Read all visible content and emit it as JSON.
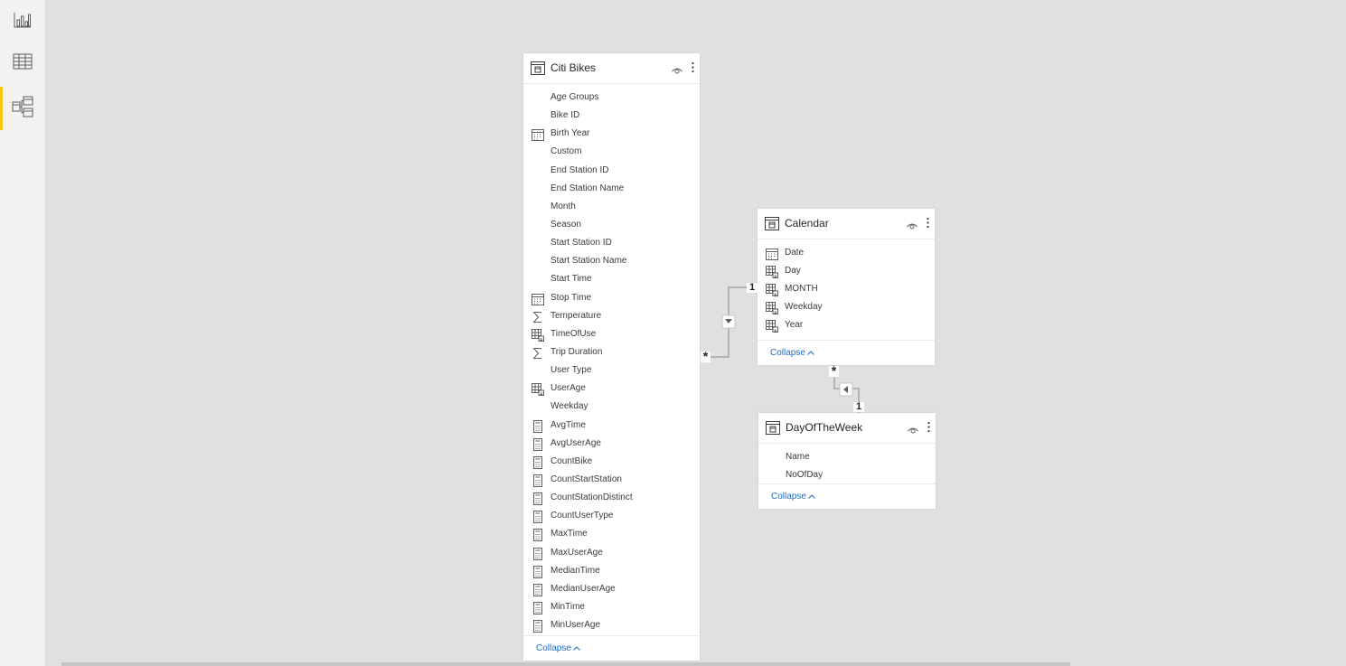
{
  "nav": {
    "items": [
      {
        "name": "report-view",
        "icon": "bar-chart-icon"
      },
      {
        "name": "data-view",
        "icon": "table-grid-icon"
      },
      {
        "name": "model-view",
        "icon": "model-diagram-icon",
        "active": true
      }
    ],
    "accent_color": "#f2c811"
  },
  "tables": {
    "citi_bikes": {
      "title": "Citi Bikes",
      "collapse_label": "Collapse",
      "fields": [
        {
          "name": "Age Groups",
          "icon": "none"
        },
        {
          "name": "Bike ID",
          "icon": "none"
        },
        {
          "name": "Birth Year",
          "icon": "calendar-icon"
        },
        {
          "name": "Custom",
          "icon": "none"
        },
        {
          "name": "End Station ID",
          "icon": "none"
        },
        {
          "name": "End Station Name",
          "icon": "none"
        },
        {
          "name": "Month",
          "icon": "none"
        },
        {
          "name": "Season",
          "icon": "none"
        },
        {
          "name": "Start Station ID",
          "icon": "none"
        },
        {
          "name": "Start Station Name",
          "icon": "none"
        },
        {
          "name": "Start Time",
          "icon": "none"
        },
        {
          "name": "Stop Time",
          "icon": "calendar-icon"
        },
        {
          "name": "Temperature",
          "icon": "sigma-icon"
        },
        {
          "name": "TimeOfUse",
          "icon": "calculated-column-icon"
        },
        {
          "name": "Trip Duration",
          "icon": "sigma-icon"
        },
        {
          "name": "User Type",
          "icon": "none"
        },
        {
          "name": "UserAge",
          "icon": "calculated-column-icon"
        },
        {
          "name": "Weekday",
          "icon": "none"
        },
        {
          "name": "AvgTime",
          "icon": "calculator-icon"
        },
        {
          "name": "AvgUserAge",
          "icon": "calculator-icon"
        },
        {
          "name": "CountBike",
          "icon": "calculator-icon"
        },
        {
          "name": "CountStartStation",
          "icon": "calculator-icon"
        },
        {
          "name": "CountStationDistinct",
          "icon": "calculator-icon"
        },
        {
          "name": "CountUserType",
          "icon": "calculator-icon"
        },
        {
          "name": "MaxTime",
          "icon": "calculator-icon"
        },
        {
          "name": "MaxUserAge",
          "icon": "calculator-icon"
        },
        {
          "name": "MedianTime",
          "icon": "calculator-icon"
        },
        {
          "name": "MedianUserAge",
          "icon": "calculator-icon"
        },
        {
          "name": "MinTime",
          "icon": "calculator-icon"
        },
        {
          "name": "MinUserAge",
          "icon": "calculator-icon"
        }
      ]
    },
    "calendar": {
      "title": "Calendar",
      "collapse_label": "Collapse",
      "fields": [
        {
          "name": "Date",
          "icon": "calendar-icon"
        },
        {
          "name": "Day",
          "icon": "calculated-column-icon"
        },
        {
          "name": "MONTH",
          "icon": "calculated-column-icon"
        },
        {
          "name": "Weekday",
          "icon": "calculated-column-icon"
        },
        {
          "name": "Year",
          "icon": "calculated-column-icon"
        }
      ]
    },
    "day_of_the_week": {
      "title": "DayOfTheWeek",
      "collapse_label": "Collapse",
      "fields": [
        {
          "name": "Name",
          "icon": "none"
        },
        {
          "name": "NoOfDay",
          "icon": "none"
        }
      ]
    }
  },
  "relationships": {
    "bikes_calendar": {
      "many_label": "*",
      "one_label": "1"
    },
    "calendar_dayofweek": {
      "many_label": "*",
      "one_label": "1"
    }
  },
  "colors": {
    "canvas": "#e1e0df",
    "link": "#1b6ec2"
  }
}
